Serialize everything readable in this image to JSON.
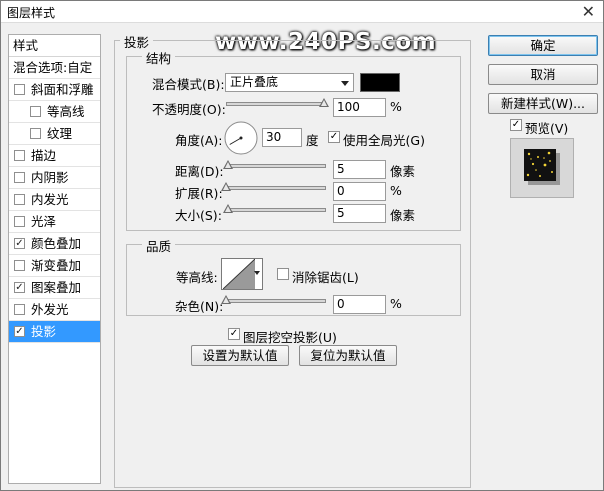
{
  "window": {
    "title": "图层样式"
  },
  "watermark": "www.240PS.com",
  "left_panel": {
    "header": "样式",
    "items": [
      {
        "label": "混合选项:自定",
        "checkbox": false,
        "checked": false,
        "indent": false,
        "selected": false
      },
      {
        "label": "斜面和浮雕",
        "checkbox": true,
        "checked": false,
        "indent": false,
        "selected": false
      },
      {
        "label": "等高线",
        "checkbox": true,
        "checked": false,
        "indent": true,
        "selected": false
      },
      {
        "label": "纹理",
        "checkbox": true,
        "checked": false,
        "indent": true,
        "selected": false
      },
      {
        "label": "描边",
        "checkbox": true,
        "checked": false,
        "indent": false,
        "selected": false
      },
      {
        "label": "内阴影",
        "checkbox": true,
        "checked": false,
        "indent": false,
        "selected": false
      },
      {
        "label": "内发光",
        "checkbox": true,
        "checked": false,
        "indent": false,
        "selected": false
      },
      {
        "label": "光泽",
        "checkbox": true,
        "checked": false,
        "indent": false,
        "selected": false
      },
      {
        "label": "颜色叠加",
        "checkbox": true,
        "checked": true,
        "indent": false,
        "selected": false
      },
      {
        "label": "渐变叠加",
        "checkbox": true,
        "checked": false,
        "indent": false,
        "selected": false
      },
      {
        "label": "图案叠加",
        "checkbox": true,
        "checked": true,
        "indent": false,
        "selected": false
      },
      {
        "label": "外发光",
        "checkbox": true,
        "checked": false,
        "indent": false,
        "selected": false
      },
      {
        "label": "投影",
        "checkbox": true,
        "checked": true,
        "indent": false,
        "selected": true
      }
    ]
  },
  "drop_shadow": {
    "title": "投影",
    "structure": {
      "title": "结构",
      "blend_mode_label": "混合模式(B):",
      "blend_mode_value": "正片叠底",
      "shadow_color": "#000000",
      "opacity_label": "不透明度(O):",
      "opacity_value": "100",
      "opacity_fraction": 1.0,
      "percent": "%",
      "angle_label": "角度(A):",
      "angle_value": "30",
      "angle_degrees": 30,
      "degree_unit": "度",
      "global_light_label": "使用全局光(G)",
      "global_light_checked": true,
      "distance_label": "距离(D):",
      "distance_value": "5",
      "distance_fraction": 0.02,
      "pixel_unit": "像素",
      "spread_label": "扩展(R):",
      "spread_value": "0",
      "spread_fraction": 0.0,
      "size_label": "大小(S):",
      "size_value": "5",
      "size_fraction": 0.02
    },
    "quality": {
      "title": "品质",
      "contour_label": "等高线:",
      "anti_alias_label": "消除锯齿(L)",
      "anti_alias_checked": false,
      "noise_label": "杂色(N):",
      "noise_value": "0",
      "noise_fraction": 0.0,
      "percent": "%"
    },
    "knockout_label": "图层挖空投影(U)",
    "knockout_checked": true,
    "make_default_label": "设置为默认值",
    "reset_default_label": "复位为默认值"
  },
  "buttons": {
    "ok": "确定",
    "cancel": "取消",
    "new_style": "新建样式(W)...",
    "preview_label": "预览(V)",
    "preview_checked": true
  },
  "check_glyph": "✓"
}
